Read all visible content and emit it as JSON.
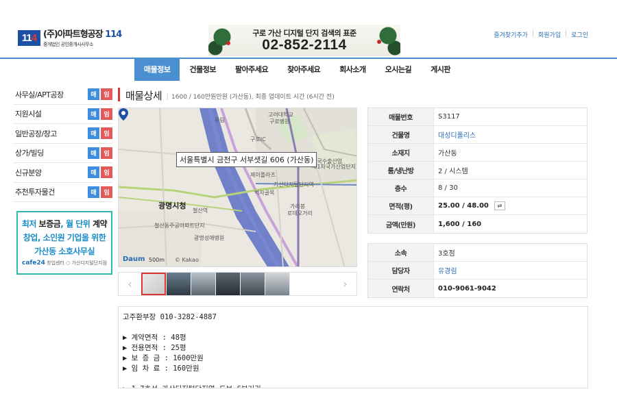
{
  "logo": {
    "box_1": "11",
    "box_2": "4",
    "main_prefix": "(주)아파트형공장",
    "main_num": "114",
    "sub": "중개법인 공인중개사사무소"
  },
  "banner": {
    "line1": "구로 가산 디지털 단지 검색의 표준",
    "phone": "02-852-2114"
  },
  "toplinks": [
    "즐겨찾기추가",
    "회원가입",
    "로그인"
  ],
  "nav": [
    "매물정보",
    "건물정보",
    "팔아주세요",
    "찾아주세요",
    "회사소개",
    "오시는길",
    "게시판"
  ],
  "sidebar": {
    "items": [
      {
        "label": "사무실/APT공장"
      },
      {
        "label": "지원시설"
      },
      {
        "label": "일반공장/창고"
      },
      {
        "label": "상가/빌딩"
      },
      {
        "label": "신규분양"
      },
      {
        "label": "추천투자물건"
      }
    ],
    "tag_buy": "매",
    "tag_rent": "임"
  },
  "promo": {
    "line1_a": "최저 ",
    "line1_b": "보증금",
    "line1_c": ", 월 단위 ",
    "line1_d": "계약",
    "line2": "창업, 소인원 기업을 위한",
    "line3": "가산동 소호사무실",
    "line4_brand": "cafe24",
    "line4_rest": "창업센터 ○ 가산디지털단지점"
  },
  "page_title": "매물상세",
  "page_subtitle": "1600 / 160만원만원 (가산동), 최종 업데이트 시간 (6시간 전)",
  "map": {
    "address": "서울특별시 금천구 서부샛길 606 (가산동)",
    "labels": {
      "yoo": "유림",
      "korea_univ": "고려대학교",
      "guro_hosp": "구로병원",
      "guro_ic": "구로IC",
      "gasan_ent": "한국수출산업",
      "gasan_ent2": "제1차국가산업단지",
      "jeil": "제이플라츠",
      "gdd": "가산디지털단지역",
      "mokjeon": "먹자골목",
      "gwangmyeong_hall": "광명시청",
      "cheolsan": "철산역",
      "apt": "철산동주공아파트단지",
      "hosp": "광명성애병원",
      "garibong": "가리봉",
      "rodeo": "로데오거리",
      "daum": "Daum",
      "scale": "500m",
      "kakao": "© Kakao"
    }
  },
  "info_main": [
    {
      "k": "매물번호",
      "v": "S3117",
      "style": ""
    },
    {
      "k": "건물명",
      "v": "대성디폴리스",
      "style": "link"
    },
    {
      "k": "소재지",
      "v": "가산동",
      "style": ""
    },
    {
      "k": "룸/냉난방",
      "v": "2 / 시스템",
      "style": ""
    },
    {
      "k": "층수",
      "v": "8 / 30",
      "style": ""
    },
    {
      "k": "면적(평)",
      "v": "25.00 / 48.00",
      "style": "bold"
    },
    {
      "k": "금액(만원)",
      "v": "1,600 / 160",
      "style": "bold"
    }
  ],
  "info_contact": [
    {
      "k": "소속",
      "v": "3호점",
      "style": ""
    },
    {
      "k": "담당자",
      "v": "유경림",
      "style": "link"
    },
    {
      "k": "연락처",
      "v": "010-9061-9042",
      "style": "bold"
    }
  ],
  "description": "고주환부장 010-3282-4887\n\n▶ 계약면적 : 48평\n▶ 전용면적 : 25평\n▶ 보 증 금 : 1600만원\n▶ 임 차 료 : 160만원\n\n▶ 1.7호선 가산디지털단지역 도보 6분거리",
  "colors": {
    "accent": "#4a8fd0",
    "buy_tag": "#3d8ee0",
    "rent_tag": "#e25a5a",
    "title_bar": "#dd3333"
  }
}
